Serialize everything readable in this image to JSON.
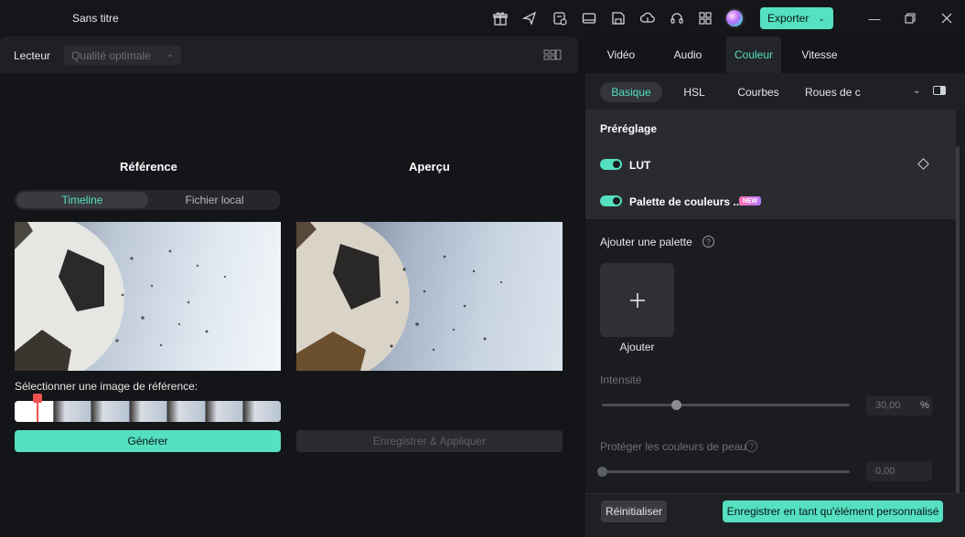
{
  "titlebar": {
    "app_title": "Sans titre",
    "export_label": "Exporter",
    "icons": [
      "gift-icon",
      "send-icon",
      "clipboard-icon",
      "display-icon",
      "save-icon",
      "cloud-upload-icon",
      "headset-icon",
      "grid-icon"
    ]
  },
  "player": {
    "label": "Lecteur",
    "quality": "Qualité optimale"
  },
  "reference": {
    "title": "Référence",
    "tab_timeline": "Timeline",
    "tab_local": "Fichier local",
    "select_label": "Sélectionner une image de référence:",
    "generate_label": "Générer"
  },
  "preview": {
    "title": "Aperçu",
    "save_apply_label": "Enregistrer & Appliquer"
  },
  "tabs": [
    "Vidéo",
    "Audio",
    "Couleur",
    "Vitesse"
  ],
  "subtabs": [
    "Basique",
    "HSL",
    "Courbes",
    "Roues de c"
  ],
  "preset": {
    "title": "Préréglage",
    "lut_label": "LUT",
    "palette_label": "Palette de couleurs ...",
    "new_badge": "NEW"
  },
  "palette": {
    "title": "Ajouter une palette",
    "add_label": "Ajouter",
    "intensity_label": "Intensité",
    "intensity_value": "30,00",
    "intensity_unit": "%",
    "intensity_level": 0.3,
    "protect_label": "Protéger les couleurs de peau",
    "protect_value": "0,00",
    "protect_level": 0.0
  },
  "footer": {
    "reset_label": "Réinitialiser",
    "save_custom_label": "Enregistrer en tant qu'élément personnalisé"
  },
  "colors": {
    "accent": "#54e0c1",
    "marker": "#ef5350"
  }
}
